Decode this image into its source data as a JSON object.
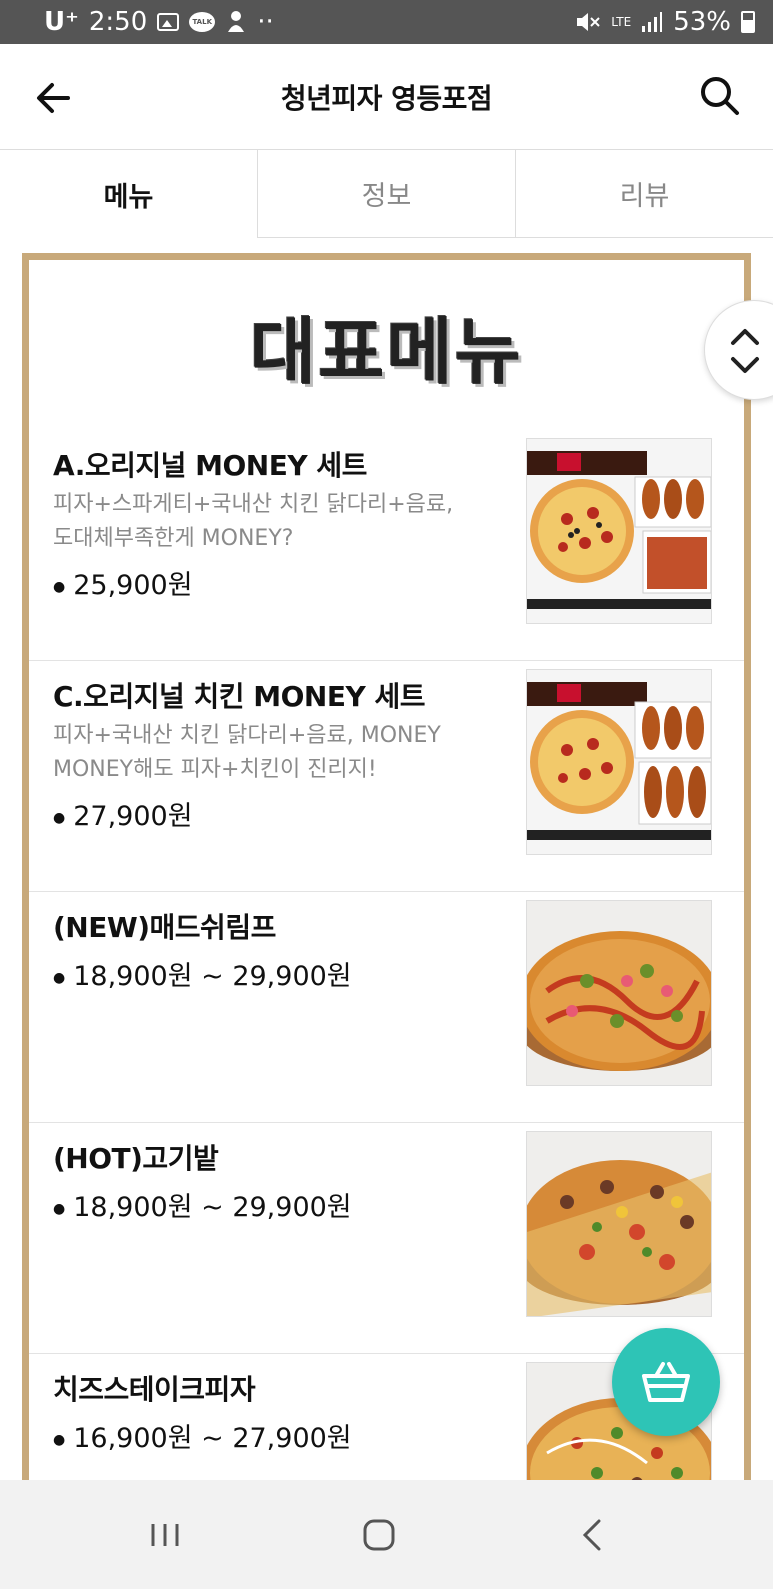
{
  "status_bar": {
    "carrier": "U⁺",
    "time": "2:50",
    "talk_label": "TALK",
    "dots": "··",
    "network": "LTE",
    "battery": "53%"
  },
  "header": {
    "title": "청년피자 영등포점"
  },
  "tabs": [
    {
      "label": "메뉴",
      "active": true
    },
    {
      "label": "정보",
      "active": false
    },
    {
      "label": "리뷰",
      "active": false
    }
  ],
  "menu": {
    "heading": "대표메뉴",
    "items": [
      {
        "name": "A.오리지널 MONEY 세트",
        "desc_lines": [
          "피자+스파게티+국내산 치킨 닭다리+음료,",
          "도대체부족한게 MONEY?"
        ],
        "price": "25,900원",
        "image": "pizza-set-spaghetti"
      },
      {
        "name": "C.오리지널 치킨 MONEY 세트",
        "desc_lines": [
          "피자+국내산 치킨 닭다리+음료, MONEY",
          "MONEY해도 피자+치킨이 진리지!"
        ],
        "price": "27,900원",
        "image": "pizza-set-chicken"
      },
      {
        "name": "(NEW)매드쉬림프",
        "desc_lines": [],
        "price": "18,900원 ~ 29,900원",
        "image": "shrimp-pizza"
      },
      {
        "name": "(HOT)고기밭",
        "desc_lines": [],
        "price": "18,900원 ~ 29,900원",
        "image": "meat-pizza"
      },
      {
        "name": "치즈스테이크피자",
        "desc_lines": [],
        "price": "16,900원 ~ 27,900원",
        "image": "cheesesteak-pizza"
      }
    ]
  },
  "colors": {
    "accent_border": "#c8a97a",
    "cart_fab": "#2ec4b6"
  },
  "icons": {
    "back": "arrow-left-icon",
    "search": "search-icon",
    "scroll": "chevron-up-down-icon",
    "cart": "basket-icon",
    "nav_recent": "recent-apps-icon",
    "nav_home": "home-icon",
    "nav_back": "nav-back-icon"
  }
}
